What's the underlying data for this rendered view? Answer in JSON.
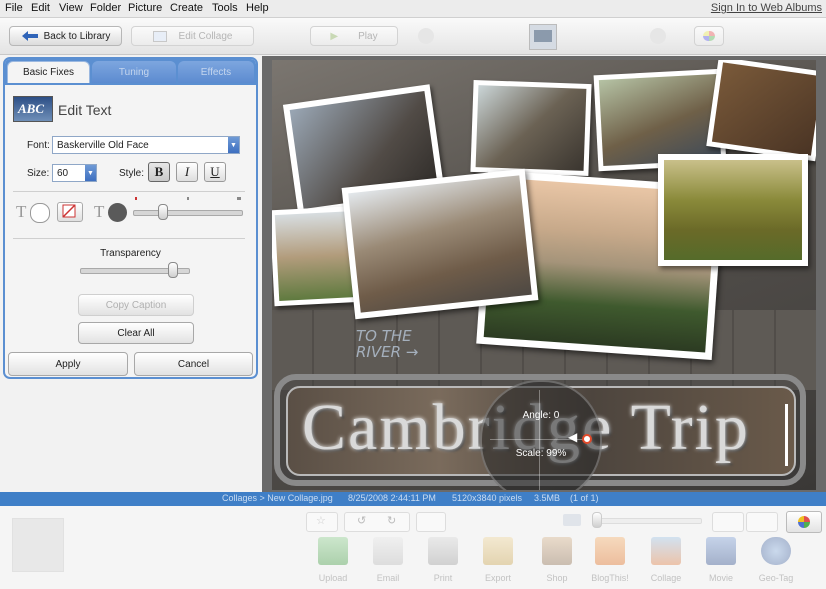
{
  "menu": [
    "File",
    "Edit",
    "View",
    "Folder",
    "Picture",
    "Create",
    "Tools",
    "Help"
  ],
  "signin": "Sign In to Web Albums",
  "toolbar": {
    "back": "Back to Library",
    "edit_collage": "Edit Collage",
    "play": "Play"
  },
  "panel": {
    "tabs": [
      "Basic Fixes",
      "Tuning",
      "Effects"
    ],
    "title": "Edit Text",
    "abc_icon_text": "ABC",
    "font_label": "Font:",
    "font_value": "Baskerville Old Face",
    "size_label": "Size:",
    "size_value": "60",
    "style_label": "Style:",
    "bold": "B",
    "italic": "I",
    "underline": "U",
    "t_glyph": "T",
    "transparency_label": "Transparency",
    "copy_caption": "Copy Caption",
    "clear_all": "Clear All",
    "apply": "Apply",
    "cancel": "Cancel"
  },
  "canvas": {
    "collage_text": "Cambridge Trip",
    "graffiti": "TO THE\nRIVER →",
    "angle": "Angle: 0",
    "scale": "Scale: 99%"
  },
  "status": {
    "path": "Collages > New Collage.jpg",
    "datetime": "8/25/2008 2:44:11 PM",
    "dims": "5120x3840 pixels",
    "size": "3.5MB",
    "count": "(1 of 1)"
  },
  "bottom_actions": [
    "Upload",
    "Email",
    "Print",
    "Export",
    "Shop",
    "BlogThis!",
    "Collage",
    "Movie",
    "Geo-Tag"
  ],
  "colors": {
    "accent": "#3f7fc7",
    "panel_border": "#5b8fd1"
  }
}
